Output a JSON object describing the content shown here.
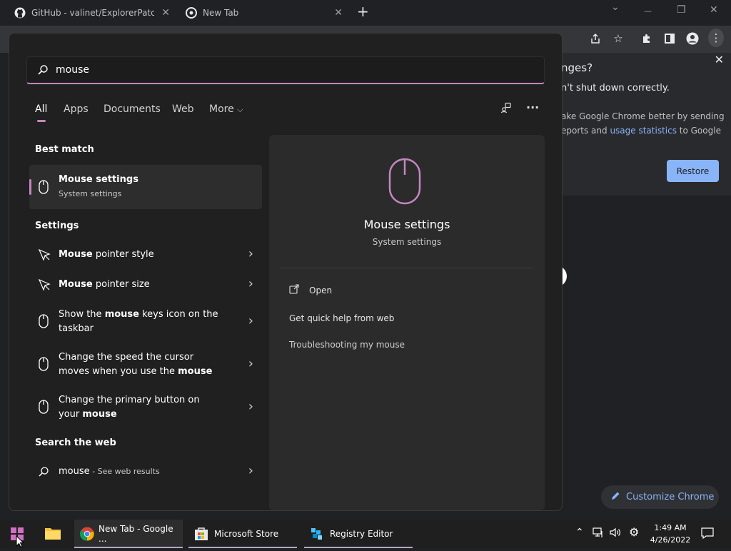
{
  "browser": {
    "tabs": [
      {
        "title": "GitHub - valinet/ExplorerPatcher",
        "close": "✕"
      },
      {
        "title": "New Tab",
        "close": "✕"
      }
    ],
    "new_tab": "+",
    "window_controls": {
      "dropdown": "⌄",
      "minimize": "—",
      "restore": "❐",
      "close": "✕"
    }
  },
  "restore_panel": {
    "line1": "nges?",
    "line2": "n't shut down correctly.",
    "line3": "ake Google Chrome better by sending",
    "line4_prefix": "eports and ",
    "line4_link": "usage statistics",
    "line4_suffix": " to Google",
    "restore_label": "Restore",
    "close": "✕"
  },
  "customize": {
    "label": "Customize Chrome"
  },
  "search": {
    "query": "mouse",
    "filters": [
      {
        "label": "All"
      },
      {
        "label": "Apps"
      },
      {
        "label": "Documents"
      },
      {
        "label": "Web"
      },
      {
        "label": "More"
      }
    ],
    "more_chevron": "⌵",
    "more_options": "···",
    "sections": {
      "best_match": "Best match",
      "settings": "Settings",
      "web": "Search the web"
    },
    "best_match": {
      "title": "Mouse settings",
      "subtitle": "System settings"
    },
    "settings_items": [
      {
        "bold": "Mouse",
        "rest": " pointer style"
      },
      {
        "bold": "Mouse",
        "rest": " pointer size"
      },
      {
        "pre": "Show the ",
        "bold": "mouse",
        "post": " keys icon on the",
        "line2": "taskbar"
      },
      {
        "pre": "Change the speed the cursor",
        "line2_pre": "moves when you use the ",
        "line2_bold": "mouse"
      },
      {
        "pre": "Change the primary button on",
        "line2_pre": "your ",
        "line2_bold": "mouse"
      }
    ],
    "web_item": {
      "query": "mouse",
      "suffix": " - See web results"
    },
    "chevron": "›",
    "preview": {
      "title": "Mouse settings",
      "subtitle": "System settings",
      "open": "Open",
      "quick_help": "Get quick help from web",
      "troubleshoot": "Troubleshooting my mouse"
    }
  },
  "taskbar": {
    "apps": [
      {
        "label": "New Tab - Google ..."
      },
      {
        "label": "Microsoft Store"
      },
      {
        "label": "Registry Editor"
      }
    ],
    "time": "1:49 AM",
    "date": "4/26/2022"
  },
  "colors": {
    "accent": "#c586c0",
    "chrome_blue": "#8ab4f8"
  }
}
